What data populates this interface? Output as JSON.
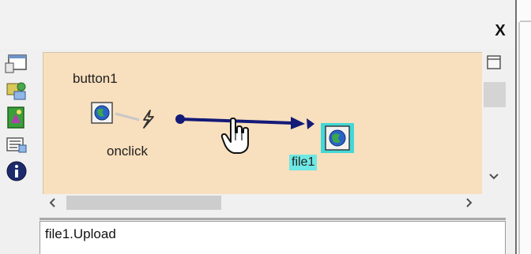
{
  "window": {
    "close_label": "X"
  },
  "canvas": {
    "source_component": "button1",
    "event_name": "onclick",
    "target_component": "file1",
    "background": "#f8dfbd",
    "link_color": "#141a78",
    "highlight_color": "#44d8d8"
  },
  "toolbar": {
    "items": [
      {
        "icon": "window-icon"
      },
      {
        "icon": "components-icon"
      },
      {
        "icon": "image-icon"
      },
      {
        "icon": "list-icon"
      },
      {
        "icon": "info-icon"
      }
    ]
  },
  "expression": {
    "value": "file1.Upload"
  },
  "cursor": {
    "icon": "hand-pointer-icon"
  }
}
